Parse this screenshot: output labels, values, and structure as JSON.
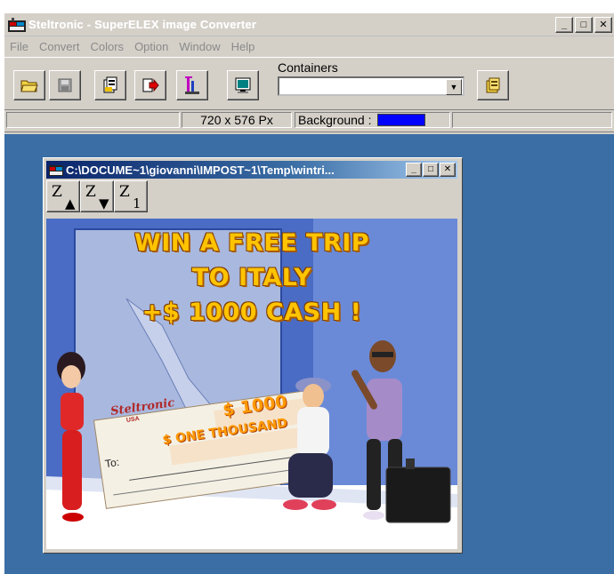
{
  "app": {
    "title": "Steltronic - SuperELEX image Converter",
    "window_controls": {
      "minimize": "_",
      "maximize": "□",
      "close": "✕"
    }
  },
  "menu": [
    "File",
    "Convert",
    "Colors",
    "Option",
    "Window",
    "Help"
  ],
  "toolbar": {
    "buttons": [
      {
        "name": "open-icon"
      },
      {
        "name": "save-icon"
      },
      {
        "name": "convert-icon"
      },
      {
        "name": "export-icon"
      },
      {
        "name": "compress-icon"
      },
      {
        "name": "monitor-icon"
      },
      {
        "name": "containers-add-icon"
      }
    ],
    "containers_label": "Containers",
    "containers_value": ""
  },
  "status": {
    "resolution": "720 x 576 Px",
    "background_label": "Background :",
    "background_color": "#0000ff"
  },
  "child_window": {
    "title": "C:\\DOCUME~1\\giovanni\\IMPOST~1\\Temp\\wintri...",
    "z_buttons": [
      {
        "letter": "Z",
        "sub": "▲"
      },
      {
        "letter": "Z",
        "sub": "▼"
      },
      {
        "letter": "Z",
        "sub": "1"
      }
    ]
  },
  "image": {
    "headline": [
      "WIN A FREE TRIP",
      "TO ITALY",
      "+$ 1000 CASH !"
    ],
    "check": {
      "brand": "Steltronic",
      "brand_sub": "USA",
      "amount": "$ 1000",
      "amount_words": "$ ONE THOUSAND",
      "to_label": "To:"
    }
  },
  "colors": {
    "desktop": "#3a6ea5",
    "face": "#d4d0c8",
    "headline": "#ffc400"
  }
}
